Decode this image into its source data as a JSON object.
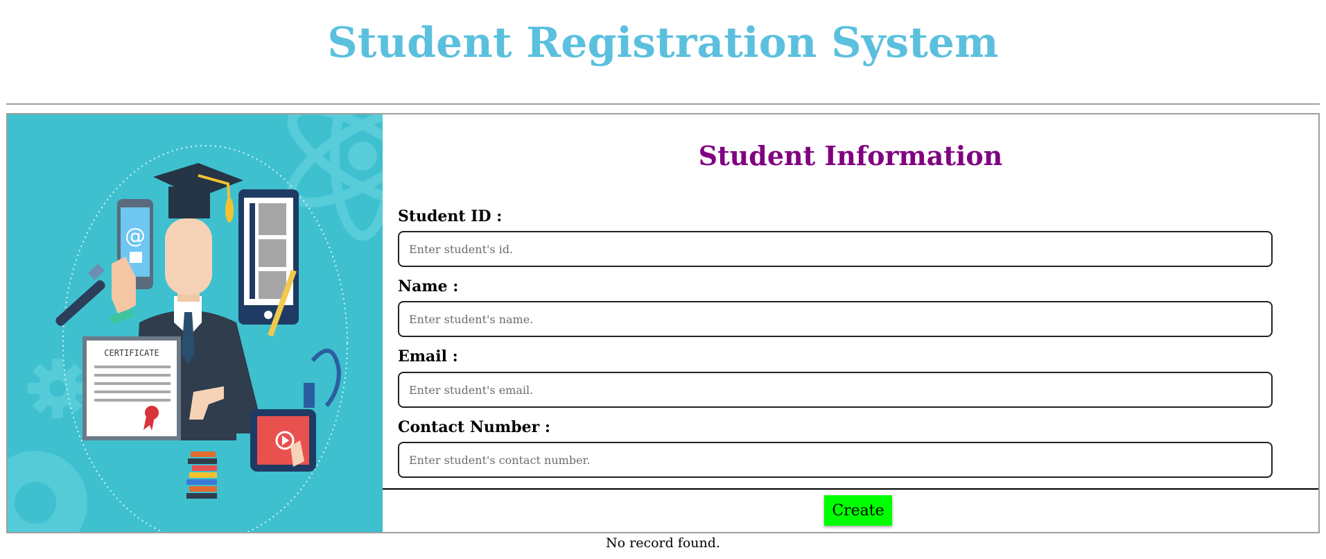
{
  "header": {
    "title": "Student Registration System"
  },
  "illustration": {
    "certificate_text": "CERTIFICATE",
    "email_symbol": "@",
    "colors": {
      "background": "#3ec0cf",
      "accent": "#5bc0de"
    }
  },
  "form": {
    "title": "Student Information",
    "fields": [
      {
        "label": "Student ID :",
        "placeholder": "Enter student's id.",
        "value": ""
      },
      {
        "label": "Name :",
        "placeholder": "Enter student's name.",
        "value": ""
      },
      {
        "label": "Email :",
        "placeholder": "Enter student's email.",
        "value": ""
      },
      {
        "label": "Contact Number :",
        "placeholder": "Enter student's contact number.",
        "value": ""
      }
    ],
    "create_label": "Create"
  },
  "status": {
    "message": "No record found."
  },
  "colors": {
    "title": "#5bc0de",
    "section_title": "#800080",
    "button": "#00ff00"
  }
}
